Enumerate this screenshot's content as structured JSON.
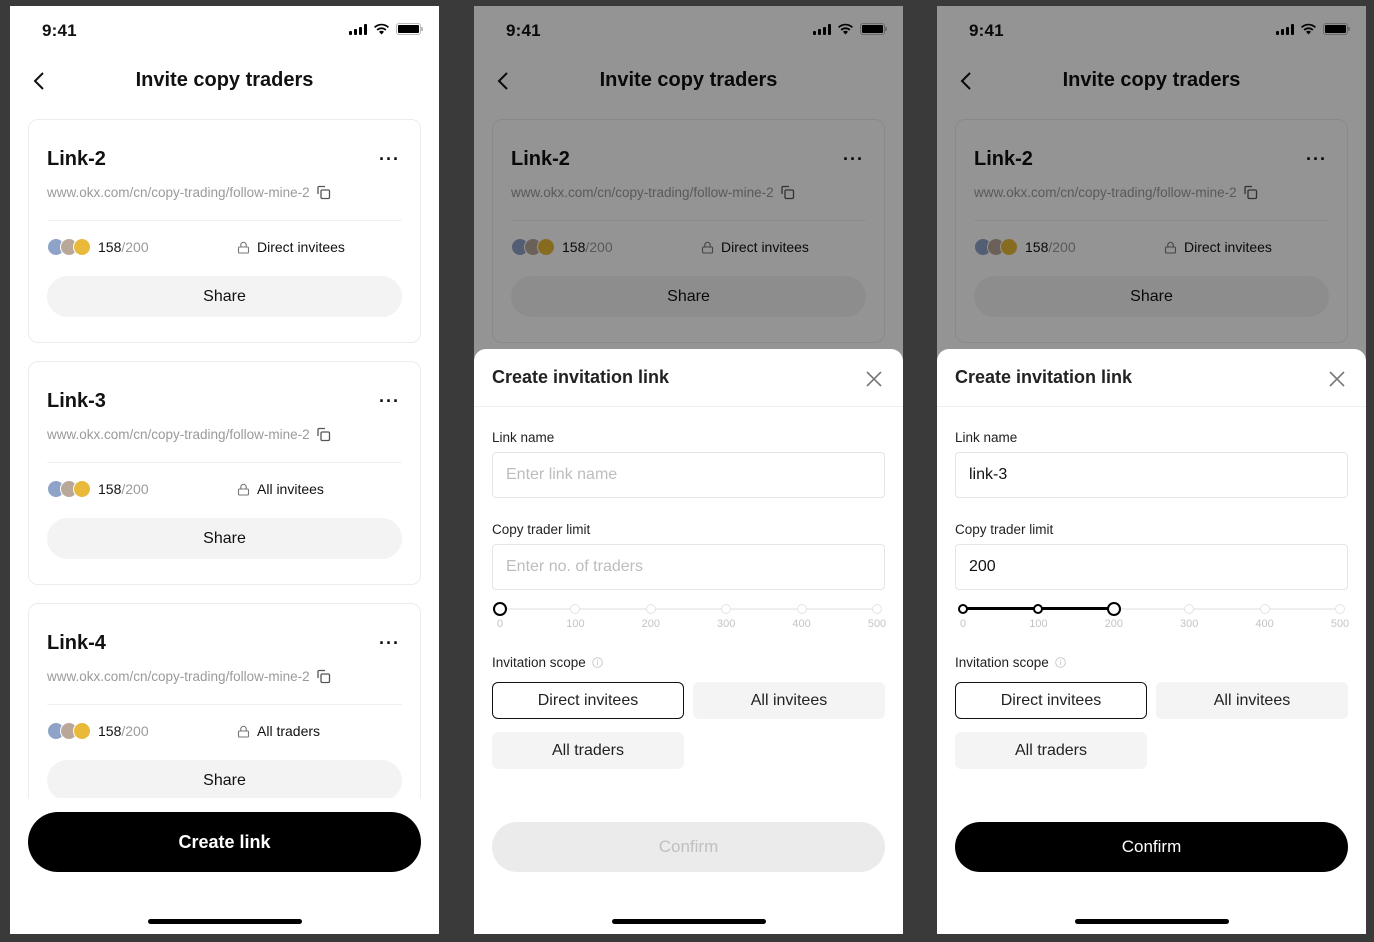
{
  "status_bar": {
    "time": "9:41"
  },
  "nav": {
    "title": "Invite copy traders"
  },
  "cards": [
    {
      "title": "Link-2",
      "url": "www.okx.com/cn/copy-trading/follow-mine-2",
      "count": "158",
      "limit": "/200",
      "scope": "Direct invitees",
      "share_label": "Share"
    },
    {
      "title": "Link-3",
      "url": "www.okx.com/cn/copy-trading/follow-mine-2",
      "count": "158",
      "limit": "/200",
      "scope": "All invitees",
      "share_label": "Share"
    },
    {
      "title": "Link-4",
      "url": "www.okx.com/cn/copy-trading/follow-mine-2",
      "count": "158",
      "limit": "/200",
      "scope": "All traders",
      "share_label": "Share"
    }
  ],
  "more_label": "···",
  "create_button": "Create link",
  "avatar_colors": [
    "#8fa3c8",
    "#b9a89a",
    "#e9b93a"
  ],
  "sheet": {
    "title": "Create invitation link",
    "link_name_label": "Link name",
    "link_name_placeholder": "Enter link name",
    "limit_label": "Copy trader limit",
    "limit_placeholder": "Enter no. of traders",
    "scope_label": "Invitation scope",
    "slider_ticks": [
      "0",
      "100",
      "200",
      "300",
      "400",
      "500"
    ],
    "slider_max": 500,
    "scope_options": [
      "Direct invitees",
      "All invitees",
      "All traders"
    ],
    "confirm_label": "Confirm"
  },
  "screens": [
    {
      "id": "empty_form",
      "link_name_value": "",
      "limit_value": "",
      "slider_value": 0,
      "selected_scope": "Direct invitees",
      "confirm_enabled": false
    },
    {
      "id": "filled_form",
      "link_name_value": "link-3",
      "limit_value": "200",
      "slider_value": 200,
      "selected_scope": "Direct invitees",
      "confirm_enabled": true
    }
  ]
}
